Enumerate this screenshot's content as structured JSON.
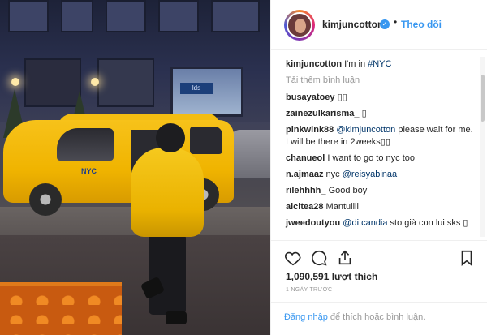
{
  "post": {
    "username": "kimjuncotton",
    "follow_label": "Theo dõi",
    "separator": "•",
    "caption": {
      "user": "kimjuncotton",
      "text": "I'm in ",
      "hashtag": "#NYC"
    },
    "load_more": "Tải thêm bình luận",
    "comments": [
      {
        "user": "busayatoey",
        "text": "▯▯"
      },
      {
        "user": "zainezulkarisma_",
        "text": "▯"
      },
      {
        "user": "pinkwink88",
        "mention": "@kimjuncotton",
        "text": " please wait for me. I will be there in 2weeks▯▯"
      },
      {
        "user": "chanueol",
        "text": "I want to go to nyc too"
      },
      {
        "user": "n.ajmaaz",
        "text": "nyc ",
        "mention": "@reisyabinaa"
      },
      {
        "user": "rilehhhh_",
        "text": "Good boy"
      },
      {
        "user": "alcitea28",
        "text": "Mantullll"
      },
      {
        "user": "jweedoutyou",
        "mention": "@di.candia",
        "text": " sto già con lui sks ▯"
      }
    ],
    "likes": "1,090,591 lượt thích",
    "time_ago": "1 NGÀY TRƯỚC",
    "footer": {
      "login": "Đăng nhập",
      "rest": " để thích hoặc bình luận."
    },
    "photo_text": {
      "store_sign": "lds",
      "taxi_logo": "NYC"
    }
  },
  "icons": [
    "heart-icon",
    "comment-icon",
    "share-icon",
    "bookmark-icon",
    "verified-badge-icon"
  ],
  "colors": {
    "link": "#3897f0",
    "mention": "#003569",
    "muted": "#999999",
    "border": "#efefef",
    "taxi": "#f2b800"
  }
}
